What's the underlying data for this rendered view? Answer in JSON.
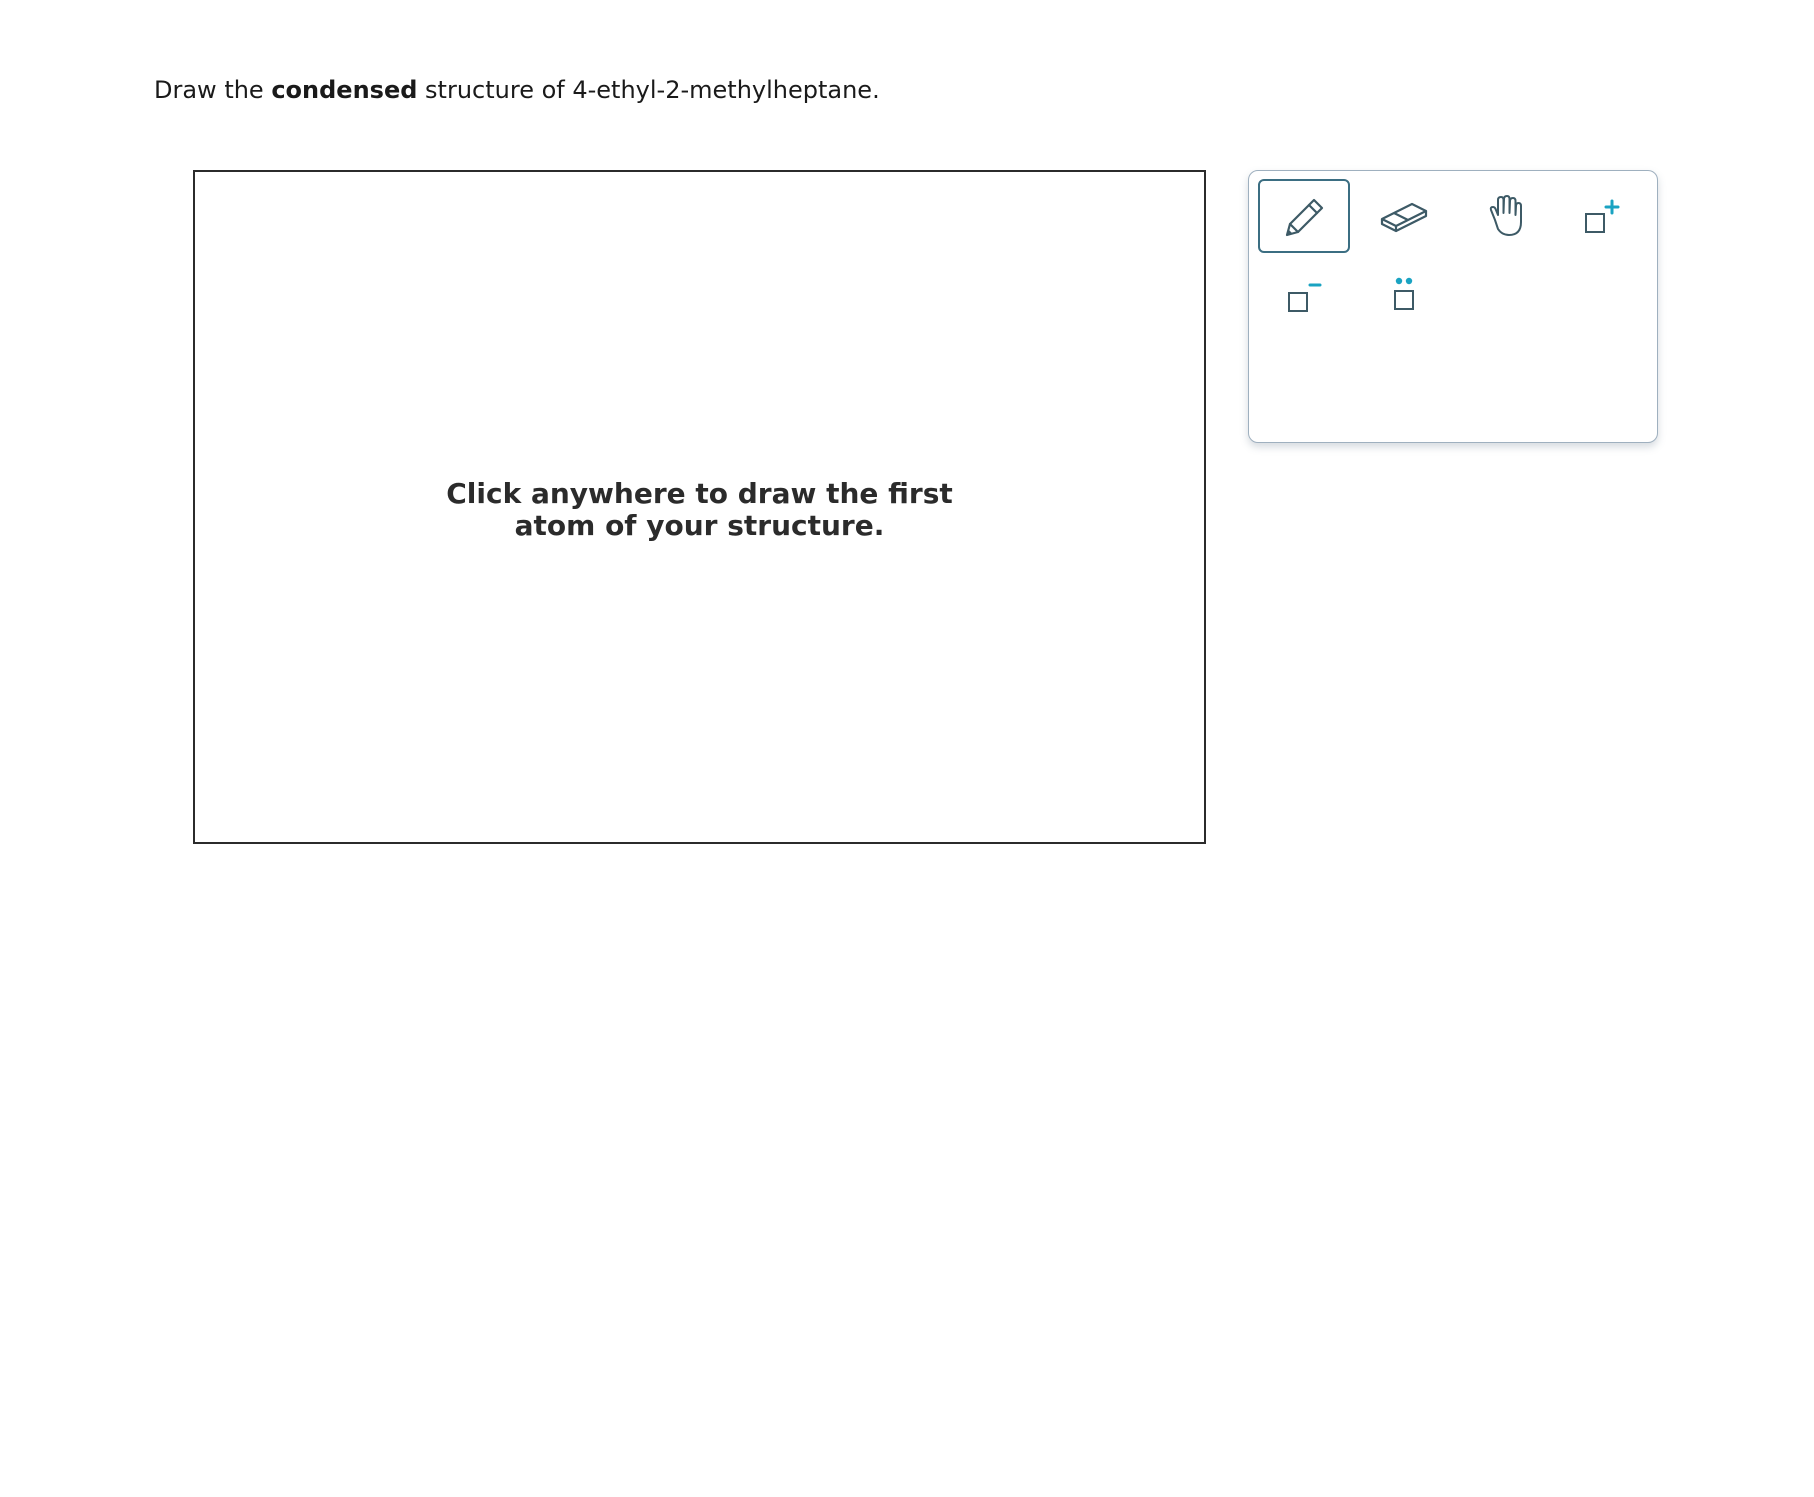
{
  "prompt": {
    "before": "Draw the ",
    "bold": "condensed",
    "after": " structure of 4-ethyl-2-methylheptane."
  },
  "canvas": {
    "hint_line1": "Click anywhere to draw the first",
    "hint_line2": "atom of your structure."
  },
  "toolbar": {
    "tools": [
      {
        "name": "pencil",
        "icon": "pencil-icon",
        "selected": true
      },
      {
        "name": "eraser",
        "icon": "eraser-icon",
        "selected": false
      },
      {
        "name": "move",
        "icon": "hand-icon",
        "selected": false
      },
      {
        "name": "positive-charge",
        "icon": "plus-charge-icon",
        "selected": false
      },
      {
        "name": "negative-charge",
        "icon": "minus-charge-icon",
        "selected": false
      },
      {
        "name": "lone-pair",
        "icon": "lone-pair-icon",
        "selected": false
      }
    ]
  },
  "colors": {
    "icon_stroke": "#3d5a66",
    "accent": "#1aa3c2",
    "selected_border": "#3b6e82"
  }
}
